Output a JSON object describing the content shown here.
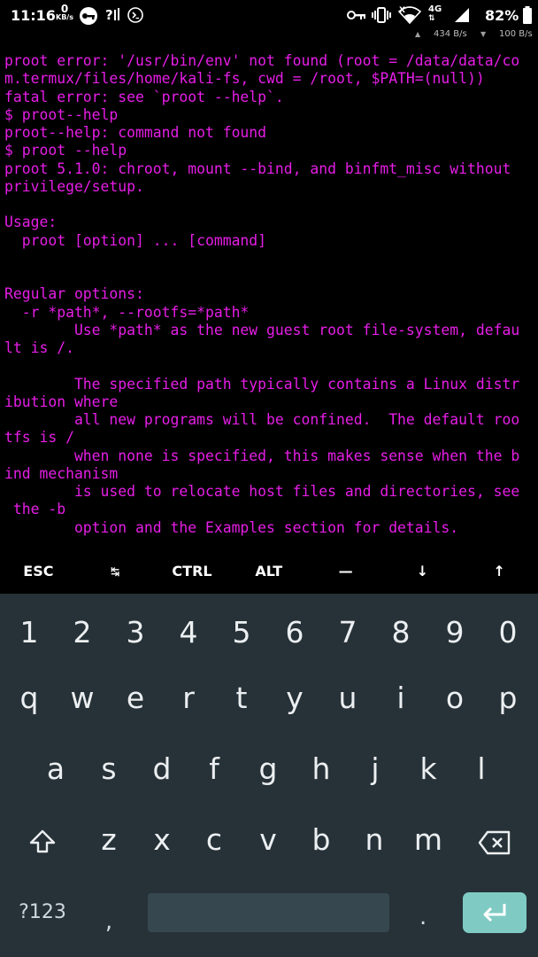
{
  "status_bar": {
    "time": "11:16",
    "net_rate_value": "0",
    "net_rate_unit": "KB/s",
    "notification_icons": [
      "vpn-key-icon",
      "question-icon",
      "terminal-icon"
    ],
    "system_icons": [
      "key-icon",
      "vibrate-icon",
      "wifi-icon",
      "network-4g-icon",
      "signal-icon",
      "battery-icon"
    ],
    "network_type": "4G",
    "battery_percent": "82%",
    "upload_speed": "434 B/s",
    "download_speed": "100 B/s"
  },
  "terminal": {
    "lines": [
      "proot error: '/usr/bin/env' not found (root = /data/data/co",
      "m.termux/files/home/kali-fs, cwd = /root, $PATH=(null))",
      "fatal error: see `proot --help`.",
      "$ proot--help",
      "proot--help: command not found",
      "$ proot --help",
      "proot 5.1.0: chroot, mount --bind, and binfmt_misc without",
      "privilege/setup.",
      "",
      "Usage:",
      "  proot [option] ... [command]",
      "",
      "",
      "Regular options:",
      "  -r *path*, --rootfs=*path*",
      "        Use *path* as the new guest root file-system, defau",
      "lt is /.",
      "",
      "        The specified path typically contains a Linux distr",
      "ibution where",
      "        all new programs will be confined.  The default roo",
      "tfs is /",
      "        when none is specified, this makes sense when the b",
      "ind mechanism",
      "        is used to relocate host files and directories, see",
      " the -b",
      "        option and the Examples section for details."
    ],
    "text_color": "#e61ee6",
    "background": "#000000"
  },
  "extra_keys": [
    "ESC",
    "↹",
    "CTRL",
    "ALT",
    "—",
    "↓",
    "↑"
  ],
  "keyboard": {
    "background": "#263238",
    "row_numbers": [
      "1",
      "2",
      "3",
      "4",
      "5",
      "6",
      "7",
      "8",
      "9",
      "0"
    ],
    "row_top": [
      "q",
      "w",
      "e",
      "r",
      "t",
      "y",
      "u",
      "i",
      "o",
      "p"
    ],
    "row_middle": [
      "a",
      "s",
      "d",
      "f",
      "g",
      "h",
      "j",
      "k",
      "l"
    ],
    "row_bottom": [
      "z",
      "x",
      "c",
      "v",
      "b",
      "n",
      "m"
    ],
    "shift_icon": "shift-icon",
    "backspace_icon": "backspace-icon",
    "symbols_label": "?123",
    "comma_label": ",",
    "period_label": ".",
    "enter_icon": "enter-icon",
    "enter_color": "#7fcbc4"
  }
}
